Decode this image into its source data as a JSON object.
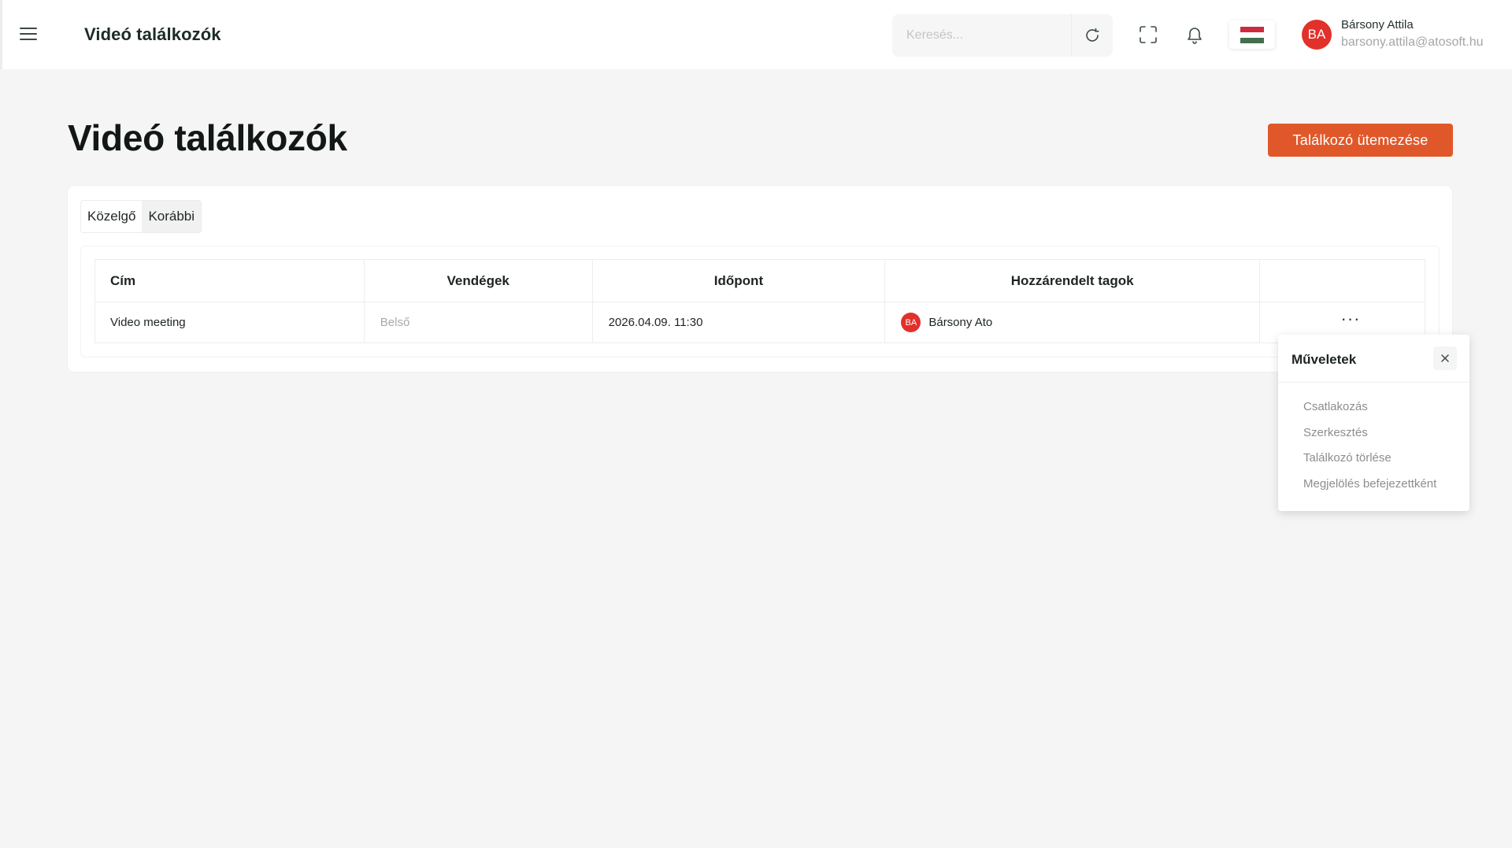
{
  "header": {
    "app_title": "Videó találkozók",
    "search_placeholder": "Keresés...",
    "user": {
      "initials": "BA",
      "name": "Bársony Attila",
      "email": "barsony.attila@atosoft.hu"
    },
    "flag_colors": [
      "#cd2a3e",
      "#ffffff",
      "#436f4d"
    ]
  },
  "page": {
    "title": "Videó találkozók",
    "primary_button_label": "Találkozó ütemezése",
    "accent_color": "#e0582a"
  },
  "tabs": [
    {
      "label": "Közelgő",
      "active": false
    },
    {
      "label": "Korábbi",
      "active": true
    }
  ],
  "table": {
    "columns": [
      "Cím",
      "Vendégek",
      "Időpont",
      "Hozzárendelt tagok",
      ""
    ],
    "rows": [
      {
        "title": "Video meeting",
        "guests": "Belső",
        "time": "2026.04.09. 11:30",
        "member_initials": "BA",
        "member_name": "Bársony Ato",
        "actions_label": "···"
      }
    ]
  },
  "actions_popover": {
    "title": "Műveletek",
    "close_label": "×",
    "items": [
      "Csatlakozás",
      "Szerkesztés",
      "Találkozó törlése",
      "Megjelölés befejezettként"
    ]
  }
}
